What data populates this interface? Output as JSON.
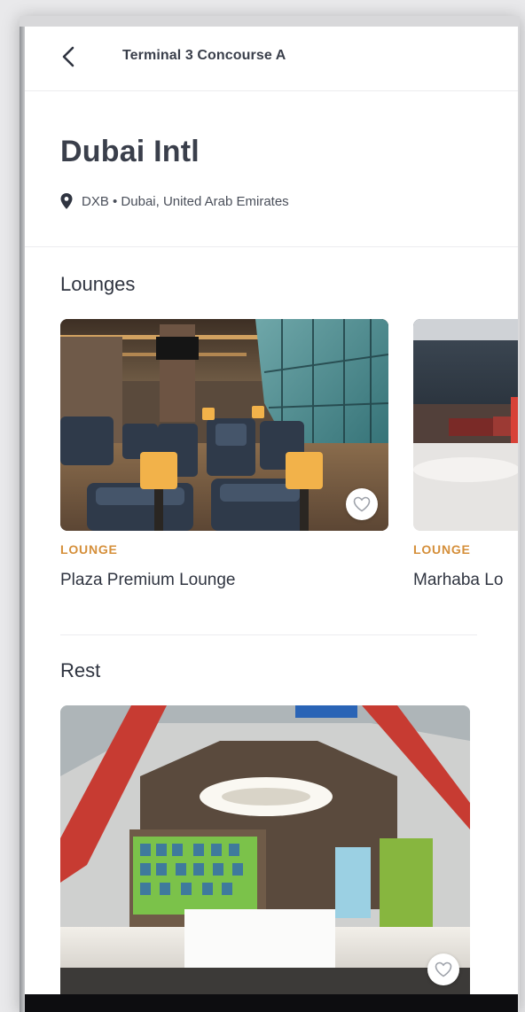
{
  "header": {
    "title": "Terminal 3 Concourse A"
  },
  "airport": {
    "name": "Dubai Intl",
    "location": "DXB • Dubai, United Arab Emirates"
  },
  "lounges": {
    "section_title": "Lounges",
    "items": [
      {
        "tag": "LOUNGE",
        "name": "Plaza Premium Lounge"
      },
      {
        "tag": "LOUNGE",
        "name": "Marhaba Lounge"
      }
    ]
  },
  "rest": {
    "section_title": "Rest"
  },
  "icons": {
    "back": "chevron-left-icon",
    "location": "map-pin-icon",
    "favorite": "heart-outline-icon"
  },
  "colors": {
    "accent": "#d58f3a",
    "text_primary": "#2f3440"
  }
}
